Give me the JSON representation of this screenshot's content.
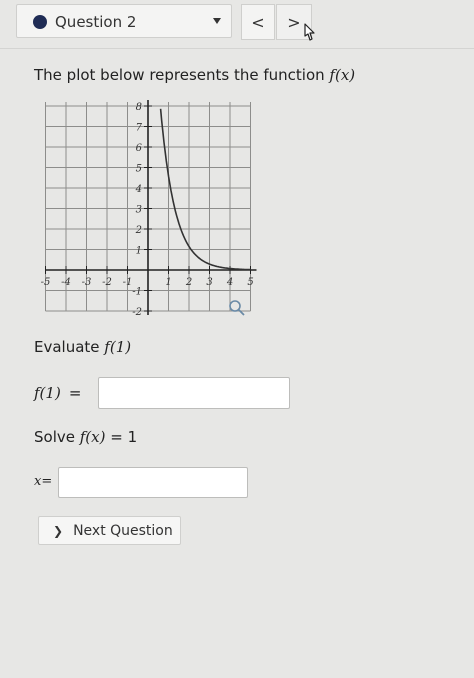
{
  "header": {
    "question_label": "Question 2",
    "prev_label": "<",
    "next_label": ">"
  },
  "main": {
    "prompt_text": "The plot below represents the function ",
    "prompt_math": "f(x)",
    "evaluate_text": "Evaluate ",
    "evaluate_math": "f(1)",
    "answer1_label": "f(1)",
    "answer1_equals": "=",
    "answer1_value": "",
    "solve_text": "Solve ",
    "solve_math": "f(x)",
    "solve_equals": "= 1",
    "answer2_label": "x=",
    "answer2_value": "",
    "next_question_label": "Next Question"
  },
  "graph": {
    "x_ticks": [
      "-5",
      "-4",
      "-3",
      "-2",
      "-1",
      "1",
      "2",
      "3",
      "4",
      "5"
    ],
    "y_ticks": [
      "8",
      "7",
      "6",
      "5",
      "4",
      "3",
      "2",
      "1",
      "-1",
      "-2"
    ],
    "x_range": [
      -5,
      5
    ],
    "y_range": [
      -2,
      8
    ],
    "grid": true,
    "curve_color": "#333333",
    "zoom_icon": "magnifier-icon"
  },
  "colors": {
    "bullet": "#1f2c55",
    "background": "#e7e7e5"
  }
}
